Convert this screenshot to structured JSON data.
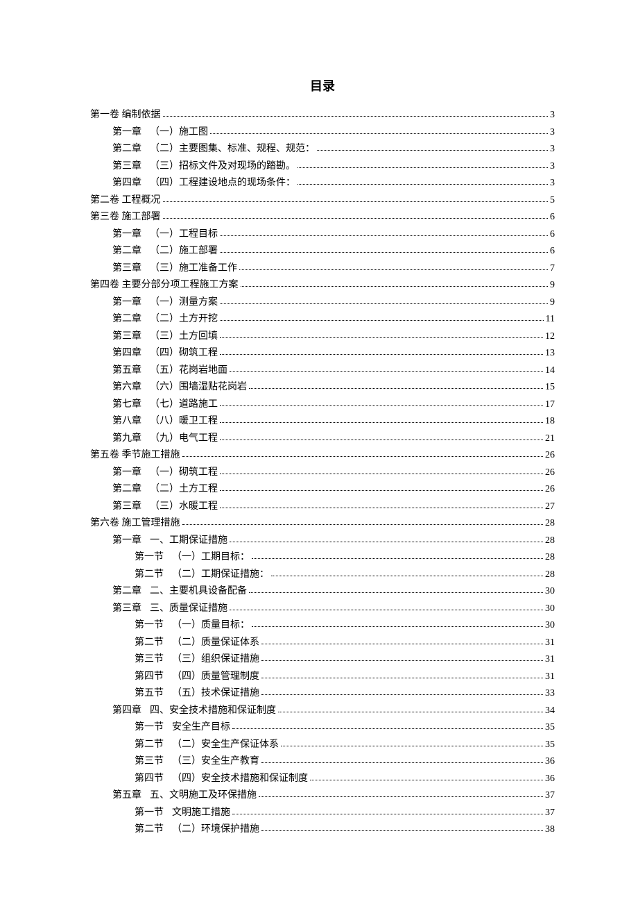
{
  "title": "目录",
  "entries": [
    {
      "level": 0,
      "prefix": "第一卷",
      "label": "编制依据",
      "page": "3"
    },
    {
      "level": 1,
      "prefix": "第一章",
      "label": "（一）施工图",
      "page": "3"
    },
    {
      "level": 1,
      "prefix": "第二章",
      "label": "（二）主要图集、标准、规程、规范：",
      "page": "3"
    },
    {
      "level": 1,
      "prefix": "第三章",
      "label": "（三）招标文件及对现场的踏勘。",
      "page": "3"
    },
    {
      "level": 1,
      "prefix": "第四章",
      "label": "（四）工程建设地点的现场条件：",
      "page": "3"
    },
    {
      "level": 0,
      "prefix": "第二卷",
      "label": "工程概况",
      "page": "5"
    },
    {
      "level": 0,
      "prefix": "第三卷",
      "label": "施工部署",
      "page": "6"
    },
    {
      "level": 1,
      "prefix": "第一章",
      "label": "（一）工程目标",
      "page": "6"
    },
    {
      "level": 1,
      "prefix": "第二章",
      "label": "（二）施工部署",
      "page": "6"
    },
    {
      "level": 1,
      "prefix": "第三章",
      "label": "（三）施工准备工作",
      "page": "7"
    },
    {
      "level": 0,
      "prefix": "第四卷",
      "label": "主要分部分项工程施工方案",
      "page": "9"
    },
    {
      "level": 1,
      "prefix": "第一章",
      "label": "（一）测量方案",
      "page": "9"
    },
    {
      "level": 1,
      "prefix": "第二章",
      "label": "（二）土方开挖",
      "page": "11"
    },
    {
      "level": 1,
      "prefix": "第三章",
      "label": "（三）土方回填",
      "page": "12"
    },
    {
      "level": 1,
      "prefix": "第四章",
      "label": "（四）砌筑工程",
      "page": "13"
    },
    {
      "level": 1,
      "prefix": "第五章",
      "label": "（五）花岗岩地面",
      "page": "14"
    },
    {
      "level": 1,
      "prefix": "第六章",
      "label": "（六）围墙湿贴花岗岩",
      "page": "15"
    },
    {
      "level": 1,
      "prefix": "第七章",
      "label": "（七）道路施工",
      "page": "17"
    },
    {
      "level": 1,
      "prefix": "第八章",
      "label": "（八）暖卫工程",
      "page": "18"
    },
    {
      "level": 1,
      "prefix": "第九章",
      "label": "（九）电气工程",
      "page": "21"
    },
    {
      "level": 0,
      "prefix": "第五卷",
      "label": "季节施工措施",
      "page": "26"
    },
    {
      "level": 1,
      "prefix": "第一章",
      "label": "（一）砌筑工程",
      "page": "26"
    },
    {
      "level": 1,
      "prefix": "第二章",
      "label": "（二）土方工程",
      "page": "26"
    },
    {
      "level": 1,
      "prefix": "第三章",
      "label": "（三）水暖工程",
      "page": "27"
    },
    {
      "level": 0,
      "prefix": "第六卷",
      "label": "施工管理措施",
      "page": "28"
    },
    {
      "level": 1,
      "prefix": "第一章",
      "label": "一、工期保证措施",
      "page": "28"
    },
    {
      "level": 2,
      "prefix": "第一节",
      "label": "（一）工期目标：",
      "page": "28"
    },
    {
      "level": 2,
      "prefix": "第二节",
      "label": "（二）工期保证措施：",
      "page": "28"
    },
    {
      "level": 1,
      "prefix": "第二章",
      "label": "二、主要机具设备配备",
      "page": "30"
    },
    {
      "level": 1,
      "prefix": "第三章",
      "label": "三、质量保证措施",
      "page": "30"
    },
    {
      "level": 2,
      "prefix": "第一节",
      "label": "（一）质量目标：",
      "page": "30"
    },
    {
      "level": 2,
      "prefix": "第二节",
      "label": "（二）质量保证体系",
      "page": "31"
    },
    {
      "level": 2,
      "prefix": "第三节",
      "label": "（三）组织保证措施",
      "page": "31"
    },
    {
      "level": 2,
      "prefix": "第四节",
      "label": "（四）质量管理制度",
      "page": "31"
    },
    {
      "level": 2,
      "prefix": "第五节",
      "label": "（五）技术保证措施",
      "page": "33"
    },
    {
      "level": 1,
      "prefix": "第四章",
      "label": "四、安全技术措施和保证制度",
      "page": "34"
    },
    {
      "level": 2,
      "prefix": "第一节",
      "label": "安全生产目标",
      "page": "35"
    },
    {
      "level": 2,
      "prefix": "第二节",
      "label": "（二）安全生产保证体系",
      "page": "35"
    },
    {
      "level": 2,
      "prefix": "第三节",
      "label": "（三）安全生产教育",
      "page": "36"
    },
    {
      "level": 2,
      "prefix": "第四节",
      "label": "（四）安全技术措施和保证制度",
      "page": "36"
    },
    {
      "level": 1,
      "prefix": "第五章",
      "label": "五、文明施工及环保措施",
      "page": "37"
    },
    {
      "level": 2,
      "prefix": "第一节",
      "label": "文明施工措施",
      "page": "37"
    },
    {
      "level": 2,
      "prefix": "第二节",
      "label": "（二）环境保护措施",
      "page": "38"
    }
  ]
}
